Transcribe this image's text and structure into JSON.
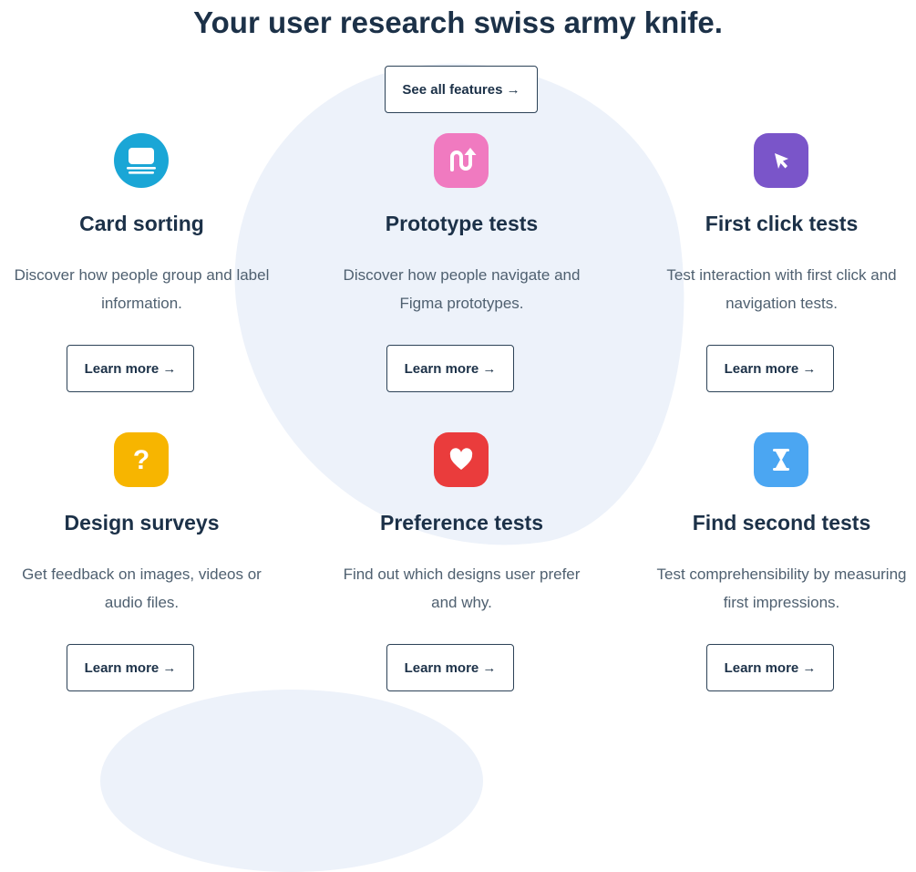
{
  "header": {
    "title": "Your user research swiss army knife.",
    "see_all_label": "See all features →"
  },
  "cards": [
    {
      "title": "Card sorting",
      "desc_line1": "Discover how people group and label",
      "desc_line2": "information.",
      "button": "Learn more →",
      "icon": "card-sorting-icon",
      "color": "#1aa6d6"
    },
    {
      "title": "Prototype tests",
      "desc_line1": "Discover how people navigate and",
      "desc_line2": "Figma prototypes.",
      "button": "Learn more →",
      "icon": "prototype-icon",
      "color": "#f07ac0"
    },
    {
      "title": "First click tests",
      "desc_line1": "Test interaction with first click and",
      "desc_line2": "navigation tests.",
      "button": "Learn more →",
      "icon": "cursor-arrow-icon",
      "color": "#7a55c9"
    },
    {
      "title": "Design surveys",
      "desc_line1": "Get feedback on images, videos or",
      "desc_line2": "audio files.",
      "button": "Learn more →",
      "icon": "question-mark-icon",
      "color": "#f7b500"
    },
    {
      "title": "Preference tests",
      "desc_line1": "Find out which designs user prefer",
      "desc_line2": "and why.",
      "button": "Learn more →",
      "icon": "heart-icon",
      "color": "#ea3c3c"
    },
    {
      "title": "Find second tests",
      "desc_line1": "Test comprehensibility by measuring",
      "desc_line2": "first impressions.",
      "button": "Learn more →",
      "icon": "hourglass-icon",
      "color": "#4ba6f2"
    }
  ]
}
